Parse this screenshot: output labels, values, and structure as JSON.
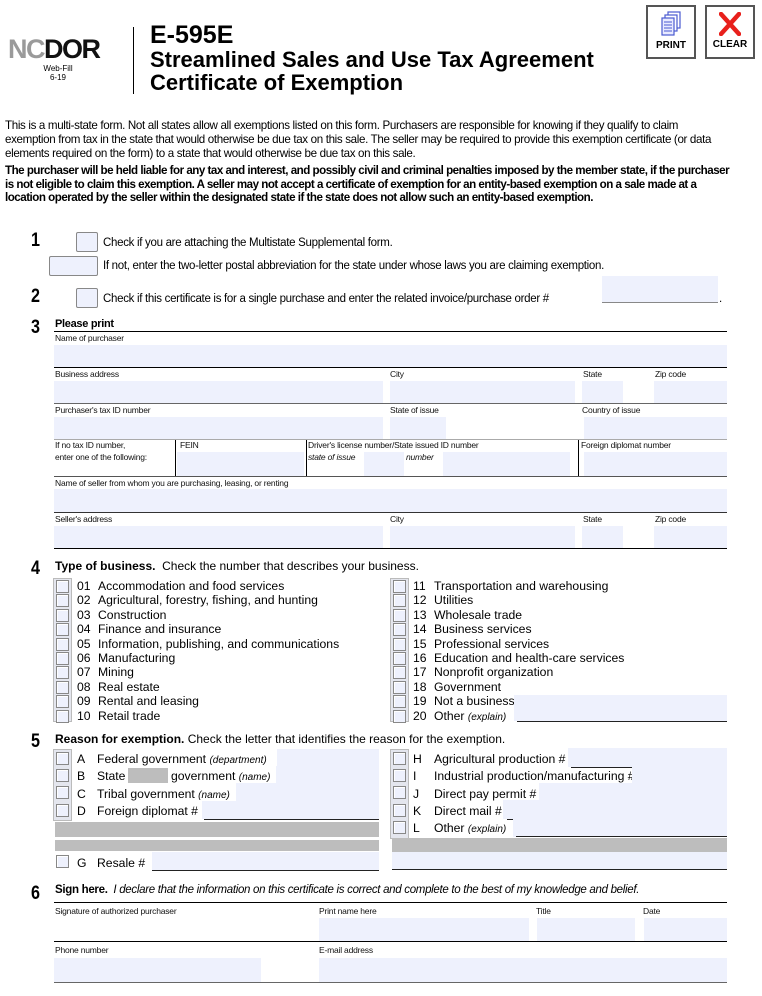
{
  "header": {
    "logo_nc": "NC",
    "logo_dor": "DOR",
    "web_fill": "Web-Fill",
    "version": "6-19",
    "form_number": "E-595E",
    "title_line1": "Streamlined Sales and Use Tax Agreement",
    "title_line2": "Certificate of Exemption",
    "print_label": "PRINT",
    "clear_label": "CLEAR"
  },
  "intro": {
    "para1": "This is a multi-state form. Not all states allow all exemptions listed on this form. Purchasers are responsible for knowing if they qualify to claim exemption from tax in the state that would otherwise be due tax on this sale. The seller may be required to provide this exemption certificate (or data elements required on the form) to a state that would otherwise be due tax on this sale.",
    "para2": "The purchaser will be held liable for any tax and interest, and possibly civil and criminal penalties imposed by the member state, if the purchaser is not eligible to claim this exemption.  A seller may not accept a certificate of exemption for an entity-based exemption on a sale made at a location operated by the seller within the designated state if the state does not allow such an entity-based exemption."
  },
  "section1": {
    "number": "1",
    "check_text": "Check if you are attaching the Multistate Supplemental form.",
    "state_text": "If not, enter the two-letter postal abbreviation for the state under whose laws you are claiming exemption.",
    "state_value": ""
  },
  "section2": {
    "number": "2",
    "check_text": "Check if this certificate is for a single purchase and enter the related invoice/purchase order #",
    "period": ".",
    "invoice_value": ""
  },
  "section3": {
    "number": "3",
    "heading": "Please print",
    "name_of_purchaser": "Name of purchaser",
    "business_address": "Business address",
    "city": "City",
    "state": "State",
    "zip": "Zip code",
    "tax_id": "Purchaser's tax ID number",
    "state_of_issue": "State of issue",
    "country_of_issue": "Country of issue",
    "no_tax_id_1": "If no tax ID number,",
    "no_tax_id_2": "enter one of the following:",
    "fein": "FEIN",
    "drivers_license": "Driver's license number/State issued ID number",
    "dl_state_of_issue": "state of issue",
    "dl_number": "number",
    "foreign_diplomat": "Foreign diplomat number",
    "seller_name": "Name of seller from whom you are purchasing, leasing, or renting",
    "seller_address": "Seller's address",
    "seller_city": "City",
    "seller_state": "State",
    "seller_zip": "Zip code"
  },
  "section4": {
    "number": "4",
    "heading": "Type of business.",
    "instruction": "Check the number that describes your business.",
    "left_items": [
      {
        "code": "01",
        "label": "Accommodation and food services"
      },
      {
        "code": "02",
        "label": "Agricultural, forestry, fishing, and hunting"
      },
      {
        "code": "03",
        "label": "Construction"
      },
      {
        "code": "04",
        "label": "Finance and insurance"
      },
      {
        "code": "05",
        "label": "Information, publishing, and communications"
      },
      {
        "code": "06",
        "label": "Manufacturing"
      },
      {
        "code": "07",
        "label": "Mining"
      },
      {
        "code": "08",
        "label": "Real estate"
      },
      {
        "code": "09",
        "label": "Rental and leasing"
      },
      {
        "code": "10",
        "label": "Retail trade"
      }
    ],
    "right_items": [
      {
        "code": "11",
        "label": "Transportation and warehousing"
      },
      {
        "code": "12",
        "label": "Utilities"
      },
      {
        "code": "13",
        "label": "Wholesale trade"
      },
      {
        "code": "14",
        "label": "Business services"
      },
      {
        "code": "15",
        "label": "Professional services"
      },
      {
        "code": "16",
        "label": "Education and health-care services"
      },
      {
        "code": "17",
        "label": "Nonprofit organization"
      },
      {
        "code": "18",
        "label": "Government"
      },
      {
        "code": "19",
        "label": "Not a business"
      },
      {
        "code": "20",
        "label": "Other",
        "note": "(explain)"
      }
    ]
  },
  "section5": {
    "number": "5",
    "heading": "Reason for exemption.",
    "instruction": "Check the letter that identifies the reason for the exemption.",
    "A": {
      "letter": "A",
      "label": "Federal government",
      "note": "(department)"
    },
    "B": {
      "letter": "B",
      "label_pre": "State",
      "label_post": "government",
      "note": "(name)"
    },
    "C": {
      "letter": "C",
      "label": "Tribal government",
      "note": "(name)"
    },
    "D": {
      "letter": "D",
      "label": "Foreign diplomat #"
    },
    "G": {
      "letter": "G",
      "label": "Resale #"
    },
    "H": {
      "letter": "H",
      "label": "Agricultural production #"
    },
    "I": {
      "letter": "I",
      "label": "Industrial production/manufacturing #"
    },
    "J": {
      "letter": "J",
      "label": "Direct pay permit #"
    },
    "K": {
      "letter": "K",
      "label": "Direct mail #"
    },
    "L": {
      "letter": "L",
      "label": "Other",
      "note": "(explain)"
    }
  },
  "section6": {
    "number": "6",
    "heading": "Sign here.",
    "declaration": "I declare that the information on this certificate is correct and complete to the best of my knowledge and belief.",
    "signature": "Signature of authorized purchaser",
    "print_name": "Print name here",
    "title": "Title",
    "date": "Date",
    "phone": "Phone number",
    "email": "E-mail address"
  }
}
